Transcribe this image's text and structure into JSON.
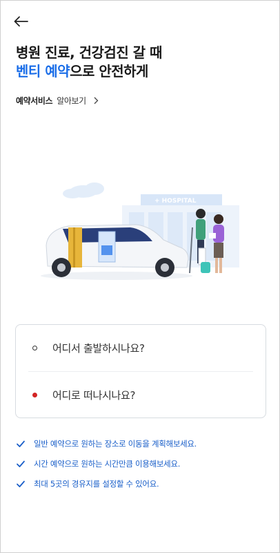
{
  "header": {
    "back_icon": "arrow-left-icon",
    "headline_line1": "병원 진료, 건강검진 갈 때",
    "headline_accent": "벤티 예약",
    "headline_rest": "으로 안전하게"
  },
  "service_link": {
    "strong": "예약서비스",
    "label": "알아보기",
    "icon": "chevron-right-icon"
  },
  "hero": {
    "hospital_sign": "+ HOSPITAL",
    "accent_color": "#1b6ee8"
  },
  "route": {
    "origin_placeholder": "어디서 출발하시나요?",
    "destination_placeholder": "어디로 떠나시나요?",
    "destination_dot_color": "#d32424"
  },
  "features": [
    "일반 예약으로 원하는 장소로 이동을 계획해보세요.",
    "시간 예약으로 원하는 시간만큼 이용해보세요.",
    "최대 5곳의 경유지를 설정할 수 있어요."
  ]
}
